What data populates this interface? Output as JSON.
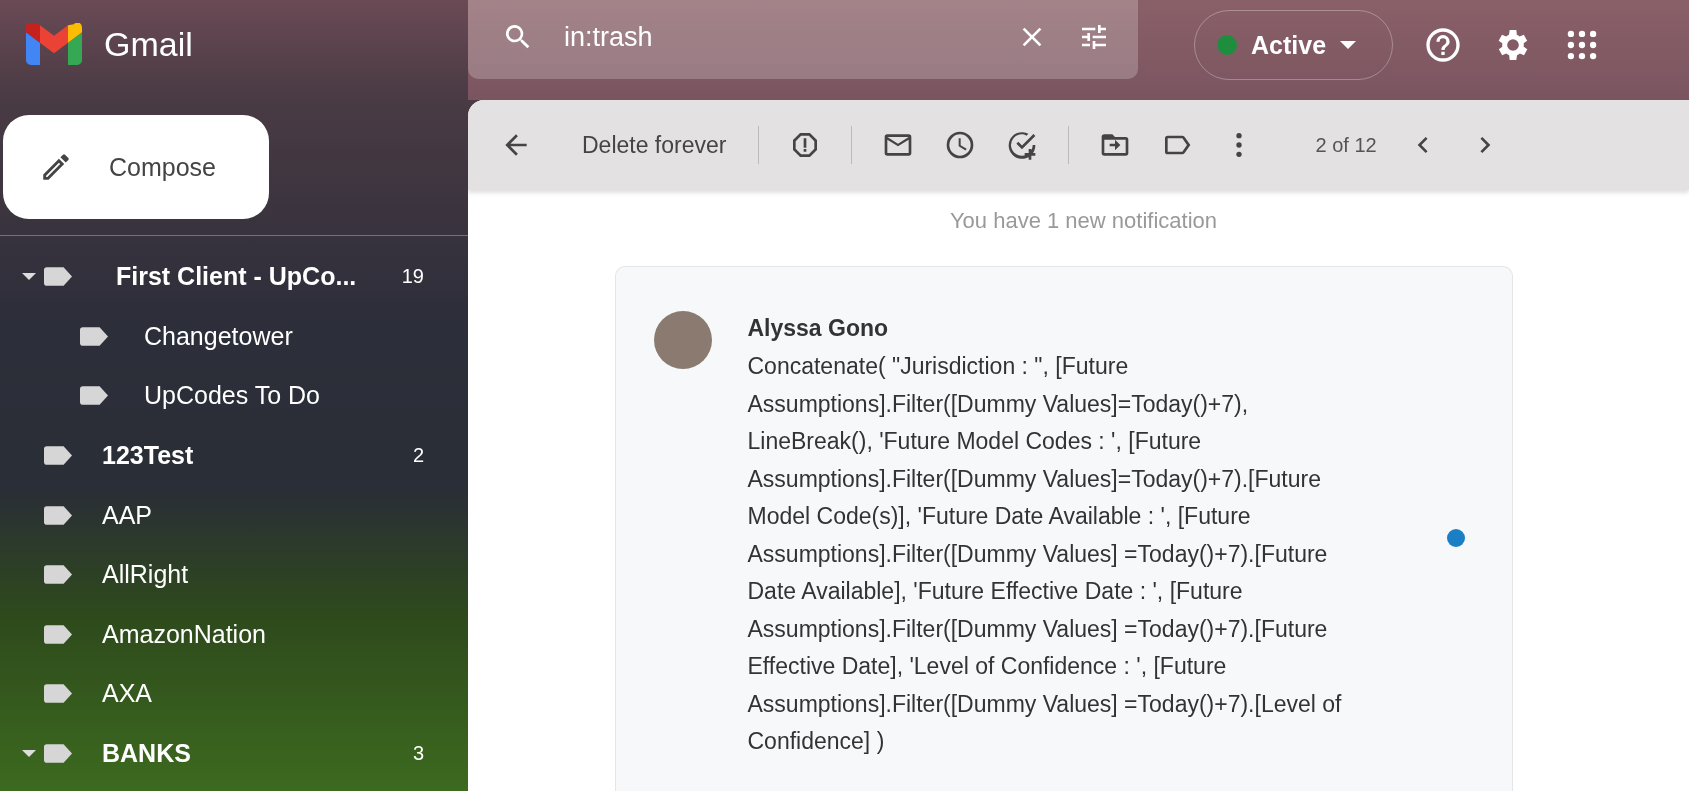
{
  "app": {
    "name": "Gmail"
  },
  "compose": {
    "label": "Compose"
  },
  "search": {
    "value": "in:trash"
  },
  "status": {
    "label": "Active",
    "on": true
  },
  "labels": [
    {
      "name": "First Client - UpCo...",
      "count": "19",
      "unread": true,
      "expanded": true,
      "children": [
        {
          "name": "Changetower",
          "unread": false
        },
        {
          "name": "UpCodes To Do",
          "unread": false
        }
      ]
    },
    {
      "name": "123Test",
      "count": "2",
      "unread": true,
      "expanded": false
    },
    {
      "name": "AAP",
      "unread": false,
      "expanded": false
    },
    {
      "name": "AllRight",
      "unread": false,
      "expanded": false
    },
    {
      "name": "AmazonNation",
      "unread": false,
      "expanded": false
    },
    {
      "name": "AXA",
      "unread": false,
      "expanded": false
    },
    {
      "name": "BANKS",
      "count": "3",
      "unread": true,
      "expanded": true
    }
  ],
  "toolbar": {
    "delete_label": "Delete forever",
    "pagination": "2 of 12"
  },
  "message": {
    "notice": "You have 1 new notification",
    "comment": {
      "author": "Alyssa Gono",
      "unread": true,
      "text": "Concatenate( \"Jurisdiction : \", [Future Assumptions].Filter([Dummy Values]=Today()+7), LineBreak(), 'Future Model Codes : ', [Future Assumptions].Filter([Dummy Values]=Today()+7).[Future Model Code(s)], 'Future Date Available : ', [Future Assumptions].Filter([Dummy Values] =Today()+7).[Future Date Available], 'Future Effective Date : ', [Future Assumptions].Filter([Dummy Values] =Today()+7).[Future Effective Date], 'Level of Confidence : ', [Future Assumptions].Filter([Dummy Values] =Today()+7).[Level of Confidence] )"
    }
  }
}
